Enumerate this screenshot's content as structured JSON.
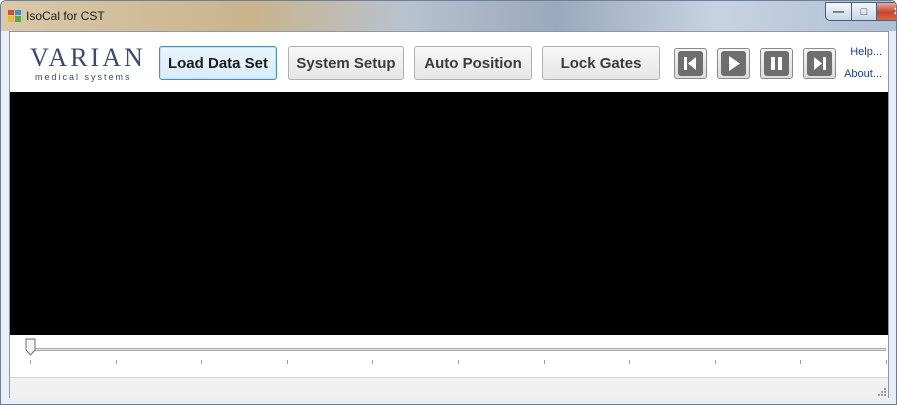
{
  "window": {
    "title": "IsoCal for CST",
    "controls": {
      "minimize": "—",
      "maximize": "□",
      "close": "✕"
    }
  },
  "logo": {
    "wordmark": "VARIAN",
    "tagline": "medical systems",
    "color": "#3c4a73"
  },
  "toolbar": {
    "buttons": [
      {
        "label": "Load Data Set",
        "active": true
      },
      {
        "label": "System Setup",
        "active": false
      },
      {
        "label": "Auto Position",
        "active": false
      },
      {
        "label": "Lock Gates",
        "active": false
      }
    ],
    "media": [
      "step-back-icon",
      "play-icon",
      "pause-icon",
      "step-forward-icon"
    ]
  },
  "links": {
    "help": "Help...",
    "about": "About..."
  },
  "display": {
    "background": "#000000"
  },
  "slider": {
    "value": 0,
    "tick_count": 11
  },
  "statusbar": {
    "text": ""
  }
}
